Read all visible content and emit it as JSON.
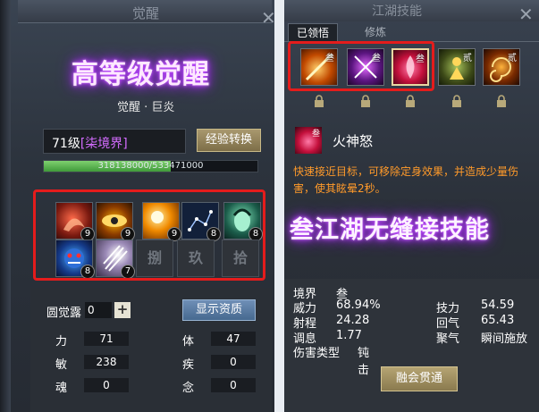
{
  "left": {
    "title": "觉醒",
    "banner": "高等级觉醒",
    "sub_name": "觉醒 · 巨炎",
    "level_text": "71级",
    "realm_text": "[柒境界]",
    "exp_button": "经验转换",
    "exp_text": "318138000/533471000",
    "exp_progress": 0.596,
    "skills": [
      {
        "icon": "flame-beast-icon",
        "level": "9"
      },
      {
        "icon": "golden-eye-icon",
        "level": "9"
      },
      {
        "icon": "sun-burst-icon",
        "level": "9"
      },
      {
        "icon": "constellation-icon",
        "level": "8"
      },
      {
        "icon": "green-face-icon",
        "level": "8"
      },
      {
        "icon": "blue-demon-icon",
        "level": "8"
      },
      {
        "icon": "claw-slash-icon",
        "level": "7"
      }
    ],
    "empty_slots": [
      "捌",
      "玖",
      "拾"
    ],
    "circle_label": "圆觉露",
    "circle_value": "0",
    "show_button": "显示资质",
    "stats": [
      {
        "label": "力",
        "value": "71"
      },
      {
        "label": "体",
        "value": "47"
      },
      {
        "label": "敏",
        "value": "238"
      },
      {
        "label": "疾",
        "value": "0"
      },
      {
        "label": "魂",
        "value": "0"
      },
      {
        "label": "念",
        "value": "0"
      }
    ]
  },
  "right": {
    "title": "江湖技能",
    "tab_active": "已领悟",
    "tab_inactive": "修炼",
    "slots": [
      {
        "icon": "fire-slash-icon",
        "tag": "叁"
      },
      {
        "icon": "cross-blades-icon",
        "tag": "叁"
      },
      {
        "icon": "fire-god-icon",
        "tag": "叁"
      },
      {
        "icon": "golden-figure-icon",
        "tag": "贰"
      },
      {
        "icon": "fire-spiral-icon",
        "tag": "贰"
      }
    ],
    "selected_name": "火神怒",
    "selected_tag": "叁",
    "description": "快速接近目标，可移除定身效果，并造成少量伤害，使其眩晕2秒。",
    "banner": "叁江湖无缝接技能",
    "stats_left": [
      {
        "label": "境界",
        "value": "叁"
      },
      {
        "label": "威力",
        "value": "68.94%"
      },
      {
        "label": "射程",
        "value": "24.28"
      },
      {
        "label": "调息",
        "value": "1.77"
      },
      {
        "label": "伤害类型",
        "value": "钝击"
      }
    ],
    "stats_right": [
      {
        "label": "技力",
        "value": "54.59"
      },
      {
        "label": "回气",
        "value": "65.43"
      },
      {
        "label": "聚气",
        "value": "瞬间施放"
      }
    ],
    "merge_button": "融会贯通"
  }
}
